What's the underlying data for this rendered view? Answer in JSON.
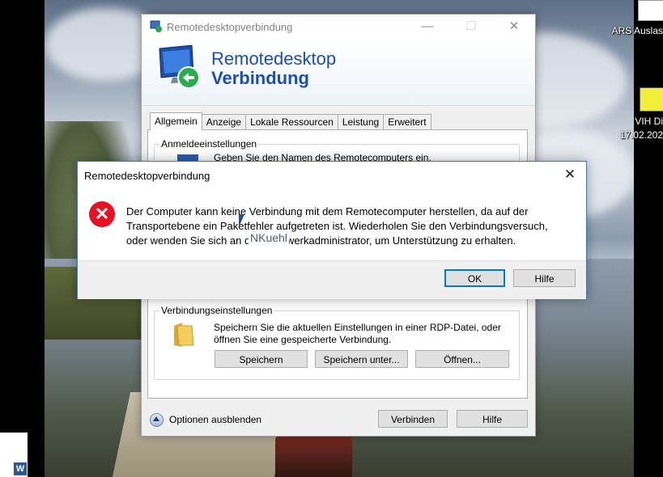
{
  "desktop": {
    "icon_right_1_label": "ARS Auslas",
    "icon_right_2_label_line1": "VIH Di",
    "icon_right_2_label_line2": "17.02.202",
    "word_badge": "W"
  },
  "window": {
    "title": "Remotedesktopverbindung",
    "banner_line1": "Remotedesktop",
    "banner_line2": "Verbindung",
    "controls": {
      "minimize": "—",
      "maximize": "☐",
      "close": "✕"
    },
    "tabs": [
      {
        "label": "Allgemein",
        "active": true
      },
      {
        "label": "Anzeige"
      },
      {
        "label": "Lokale Ressourcen"
      },
      {
        "label": "Leistung"
      },
      {
        "label": "Erweitert"
      }
    ],
    "login_group_title": "Anmeldeeinstellungen",
    "login_text_partial": "Geben Sie den Namen des Remotecomputers ein.",
    "conn_group_title": "Verbindungseinstellungen",
    "conn_text_line1": "Speichern Sie die aktuellen Einstellungen in einer RDP-Datei, oder",
    "conn_text_line2": "öffnen Sie eine gespeicherte Verbindung.",
    "btn_save": "Speichern",
    "btn_save_as": "Speichern unter...",
    "btn_open": "Öffnen...",
    "options_label": "Optionen ausblenden",
    "btn_connect": "Verbinden",
    "btn_help": "Hilfe"
  },
  "dialog": {
    "title": "Remotedesktopverbindung",
    "close": "✕",
    "icon_symbol": "✕",
    "message_line1": "Der Computer kann keine Verbindung mit dem Remotecomputer herstellen, da auf der",
    "message_line2": "Transportebene ein Paketfehler aufgetreten ist. Wiederholen Sie den Verbindungsversuch,",
    "message_line3": "oder wenden Sie sich an den Netzwerkadministrator, um Unterstützung zu erhalten.",
    "overlay_username": "NKuehl",
    "btn_ok": "OK",
    "btn_help": "Hilfe"
  }
}
